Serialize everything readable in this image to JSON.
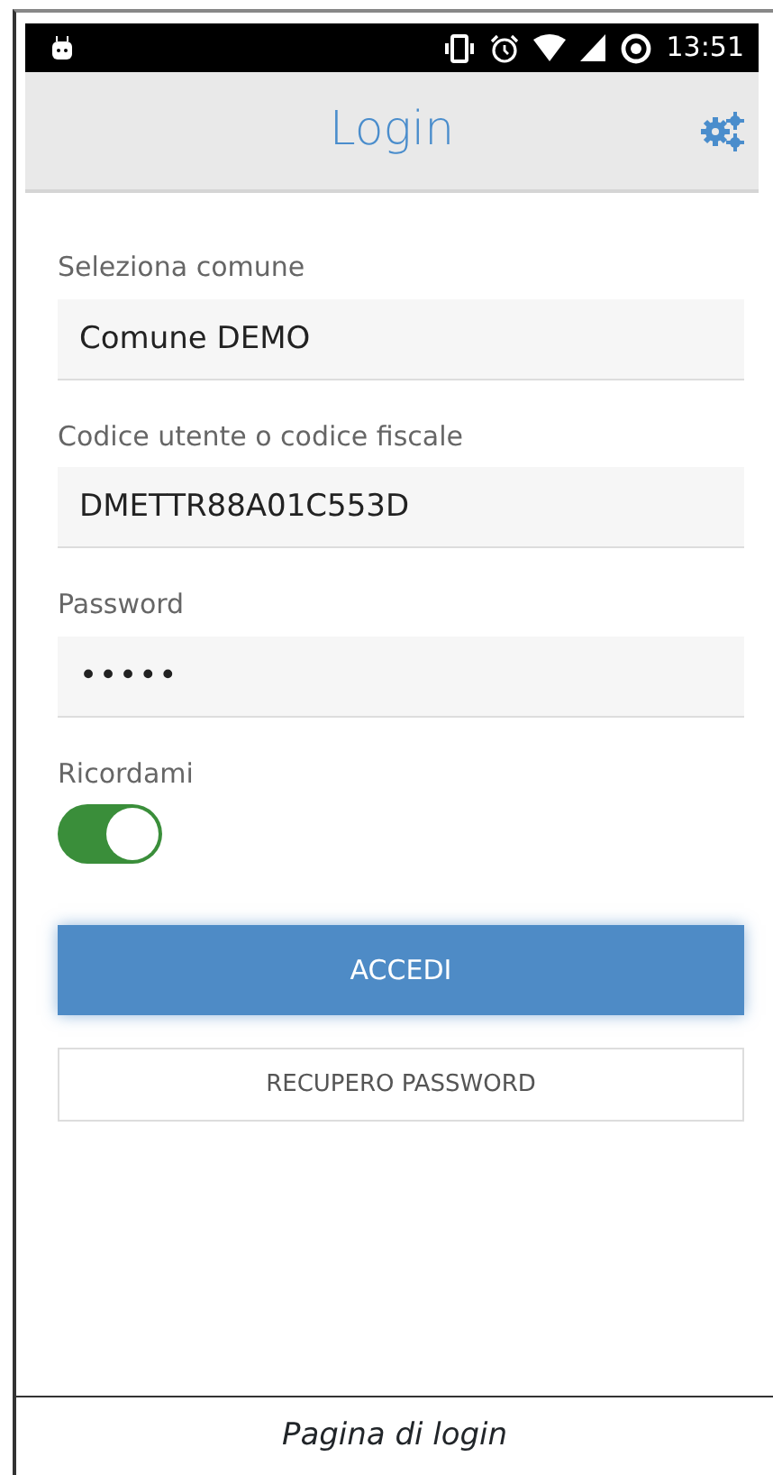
{
  "status_bar": {
    "time": "13:51"
  },
  "header": {
    "title": "Login"
  },
  "fields": [
    {
      "label": "Seleziona comune",
      "value": "Comune DEMO",
      "kind": "text"
    },
    {
      "label": "Codice utente o codice fiscale",
      "value": "DMETTR88A01C553D",
      "kind": "text"
    },
    {
      "label": "Password",
      "value": "•••••",
      "kind": "password"
    }
  ],
  "remember": {
    "label": "Ricordami",
    "on": true
  },
  "buttons": [
    {
      "label": "ACCEDI",
      "kind": "primary"
    },
    {
      "label": "RECUPERO PASSWORD",
      "kind": "secondary"
    }
  ],
  "caption": "Pagina di login"
}
